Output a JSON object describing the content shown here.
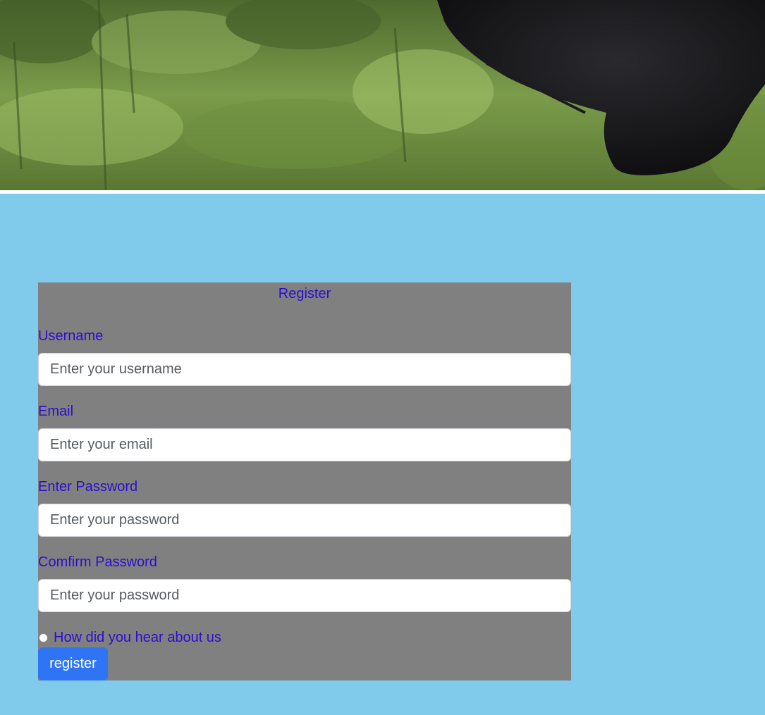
{
  "hero": {
    "image_name": "gorilla-in-grass-photo"
  },
  "form": {
    "title": "Register",
    "fields": [
      {
        "label": "Username",
        "placeholder": "Enter your username",
        "value": ""
      },
      {
        "label": "Email",
        "placeholder": "Enter your email",
        "value": ""
      },
      {
        "label": "Enter Password",
        "placeholder": "Enter your password",
        "value": ""
      },
      {
        "label": "Comfirm Password",
        "placeholder": "Enter your password",
        "value": ""
      }
    ],
    "radio_label": "How did you hear about us",
    "submit_label": "register"
  },
  "colors": {
    "page_background": "#80caeb",
    "panel_background": "#808080",
    "label_text": "#2a0fd0",
    "button_background": "#2f74f5"
  }
}
